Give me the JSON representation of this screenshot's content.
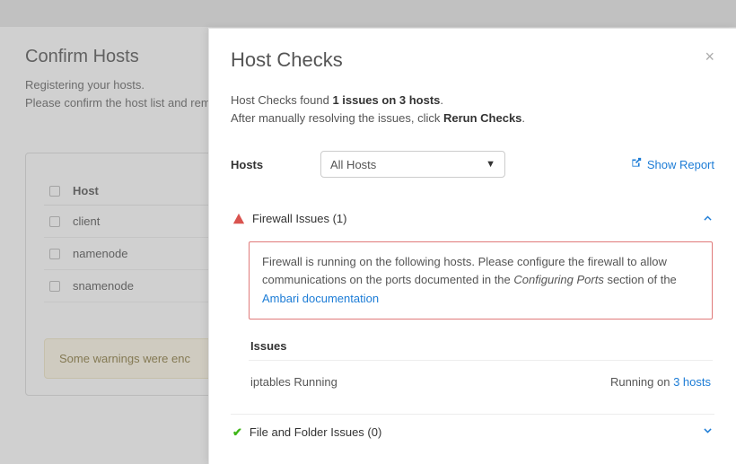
{
  "background": {
    "title": "Confirm Hosts",
    "subtitle_line1": "Registering your hosts.",
    "subtitle_line2": "Please confirm the host list and remo",
    "table_header": "Host",
    "rows": [
      "client",
      "namenode",
      "snamenode"
    ],
    "warning_text": "Some warnings were enc"
  },
  "modal": {
    "title": "Host Checks",
    "summary_prefix": "Host Checks found ",
    "summary_issues": "1 issues on 3 hosts",
    "summary_after": "After manually resolving the issues, click ",
    "summary_action": "Rerun Checks",
    "hosts_label": "Hosts",
    "hosts_selected": "All Hosts",
    "show_report": "Show Report",
    "firewall": {
      "title": "Firewall Issues (1)",
      "warn_prefix": "Firewall is running on the following hosts. Please configure the firewall to allow communications on the ports documented in the ",
      "warn_em": "Configuring Ports",
      "warn_mid": " section of the ",
      "warn_link": "Ambari documentation",
      "issues_header": "Issues",
      "issue_name": "iptables Running",
      "issue_status_prefix": "Running on ",
      "issue_status_link": "3 hosts"
    },
    "file_folder": {
      "title": "File and Folder Issues (0)"
    }
  }
}
